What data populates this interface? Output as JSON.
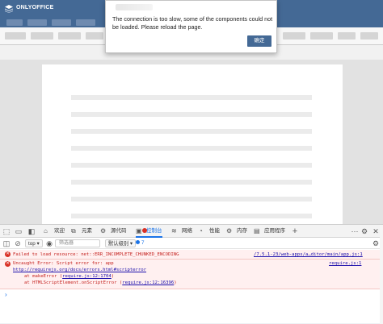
{
  "app": {
    "name": "ONLYOFFICE"
  },
  "dialog": {
    "message": "The connection is too slow, some of the components could not be loaded. Please reload the page.",
    "ok_label": "确定"
  },
  "devtools": {
    "tabs": [
      {
        "label": "欢迎",
        "icon": "home-icon"
      },
      {
        "label": "元素",
        "icon": "elements-icon"
      },
      {
        "label": "源代码",
        "icon": "sources-icon"
      },
      {
        "label": "控制台",
        "icon": "console-icon",
        "active": true
      },
      {
        "label": "网络",
        "icon": "wifi-icon"
      },
      {
        "label": "性能",
        "icon": "performance-icon"
      },
      {
        "label": "内存",
        "icon": "memory-icon"
      },
      {
        "label": "应用程序",
        "icon": "application-icon"
      }
    ],
    "filter": {
      "context": "top",
      "placeholder": "筛选器",
      "levels": "默认级别",
      "count": "7"
    },
    "messages": [
      {
        "text": "Failed to load resource: net::ERR_INCOMPLETE_CHUNKED_ENCODING",
        "source": "/7.5.1-23/web-apps/a…ditor/main/app.js:1"
      },
      {
        "line1": "Uncaught Error: Script error for: app",
        "line2": "http://requirejs.org/docs/errors.html#scripterror",
        "line3_prefix": "at makeError (",
        "line3_link": "require.js:12:1704",
        "line3_suffix": ")",
        "line4_prefix": "at HTMLScriptElement.onScriptError (",
        "line4_link": "require.js:12:16396",
        "line4_suffix": ")",
        "source": "require.js:1"
      }
    ]
  }
}
